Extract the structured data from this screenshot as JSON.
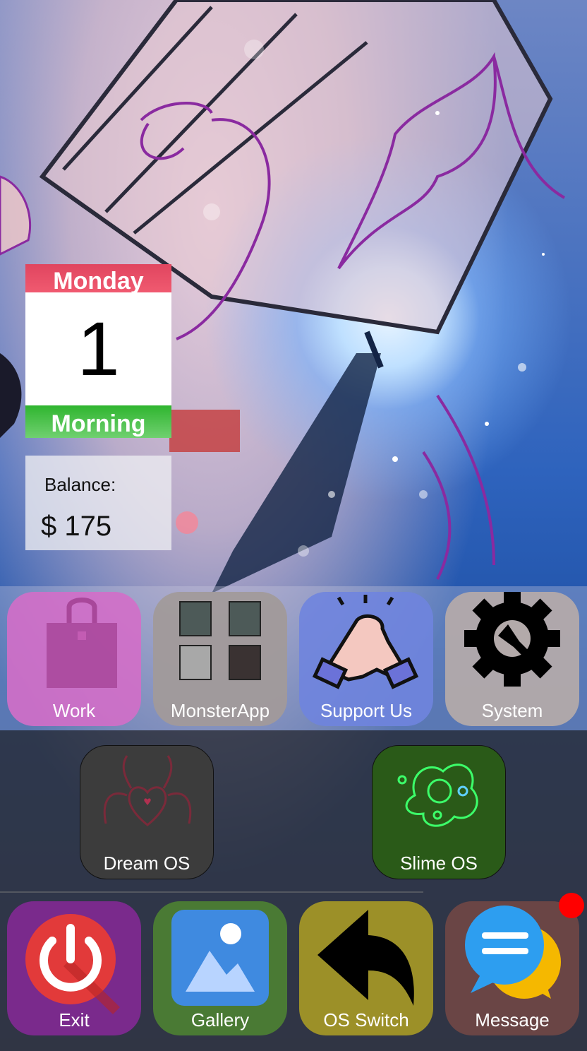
{
  "calendar": {
    "weekday": "Monday",
    "day": "1",
    "period": "Morning"
  },
  "balance": {
    "label": "Balance:",
    "value": "$ 175"
  },
  "apps_row1": [
    {
      "label": "Work",
      "icon": "shopping-bag-icon"
    },
    {
      "label": "MonsterApp",
      "icon": "grid-icon"
    },
    {
      "label": "Support Us",
      "icon": "handshake-icon"
    },
    {
      "label": "System",
      "icon": "gear-icon"
    }
  ],
  "apps_row2": [
    {
      "label": "Dream OS",
      "icon": "demon-heart-icon"
    },
    {
      "label": "Slime OS",
      "icon": "slime-icon"
    }
  ],
  "dock": [
    {
      "label": "Exit",
      "icon": "power-icon"
    },
    {
      "label": "Gallery",
      "icon": "image-icon"
    },
    {
      "label": "OS Switch",
      "icon": "back-arrow-icon"
    },
    {
      "label": "Message",
      "icon": "chat-icon"
    }
  ],
  "colors": {
    "work": "#d36ec8",
    "monsterapp": "#a19a9a",
    "support": "#6f84de",
    "system": "#b3aaaa",
    "dream": "#3c3c3c",
    "slime": "#2a5a18",
    "exit": "#7a2a8c",
    "gallery": "#4a7a34",
    "osswitch": "#9c9028",
    "message": "#6a4545",
    "notification": "#ff0000"
  }
}
